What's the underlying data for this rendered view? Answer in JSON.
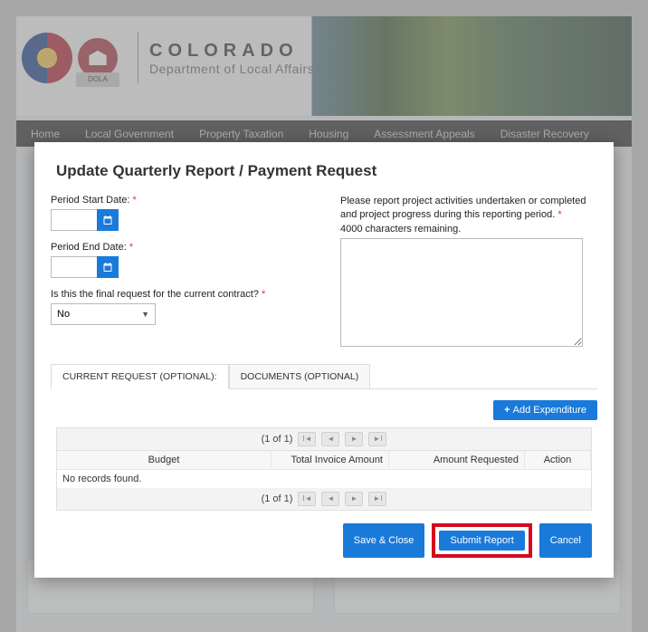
{
  "header": {
    "main": "COLORADO",
    "sub": "Department of Local Affairs",
    "dola_tag": "DOLA"
  },
  "nav": {
    "items": [
      "Home",
      "Local Government",
      "Property Taxation",
      "Housing",
      "Assessment Appeals",
      "Disaster Recovery"
    ]
  },
  "modal": {
    "title": "Update Quarterly Report / Payment Request",
    "period_start_label": "Period Start Date:",
    "period_start_value": "",
    "period_end_label": "Period End Date:",
    "period_end_value": "",
    "final_request_label": "Is this the final request for the current contract?",
    "final_request_value": "No",
    "activities_instruction": "Please report project activities undertaken or completed and project progress during this reporting period.",
    "chars_remaining": "4000 characters remaining.",
    "activities_value": ""
  },
  "tabs": {
    "current": "CURRENT REQUEST (OPTIONAL):",
    "documents": "DOCUMENTS (OPTIONAL)"
  },
  "grid": {
    "add_button": "Add Expenditure",
    "pager": "(1 of 1)",
    "headers": {
      "budget": "Budget",
      "invoice": "Total Invoice Amount",
      "amount": "Amount Requested",
      "action": "Action"
    },
    "empty_msg": "No records found."
  },
  "footer": {
    "save": "Save & Close",
    "submit": "Submit Report",
    "cancel": "Cancel"
  }
}
